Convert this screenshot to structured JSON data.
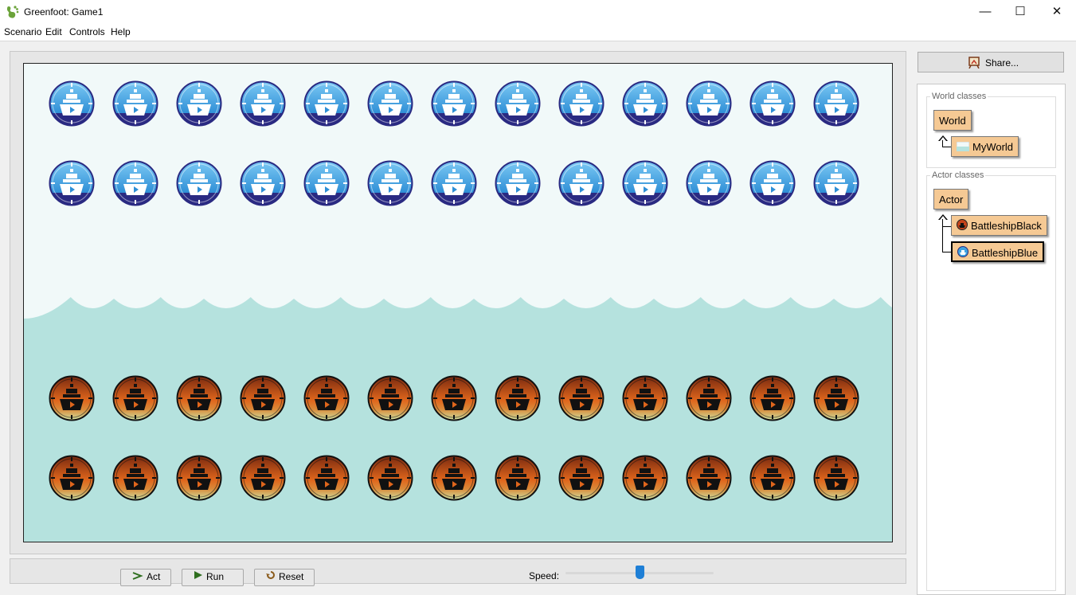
{
  "window": {
    "title": "Greenfoot: Game1",
    "minimize_glyph": "—",
    "maximize_glyph": "☐",
    "close_glyph": "✕"
  },
  "menu": [
    "Scenario",
    "Edit",
    "Controls",
    "Help"
  ],
  "share": {
    "label": "Share..."
  },
  "world_classes": {
    "title": "World classes",
    "root": "World",
    "children": [
      "MyWorld"
    ]
  },
  "actor_classes": {
    "title": "Actor classes",
    "root": "Actor",
    "children": [
      "BattleshipBlack",
      "BattleshipBlue"
    ],
    "selected": "BattleshipBlue"
  },
  "controls": {
    "act_label": "Act",
    "run_label": "Run",
    "reset_label": "Reset",
    "speed_label": "Speed:",
    "speed_fraction": 0.5
  },
  "world": {
    "sky_color": "#f1f9f9",
    "sea_color": "#b5e2de",
    "columns": 13,
    "blue_ship_rows": 2,
    "black_ship_rows": 2,
    "blue_ship_icon": "battleship-blue-icon",
    "black_ship_icon": "battleship-black-icon"
  }
}
